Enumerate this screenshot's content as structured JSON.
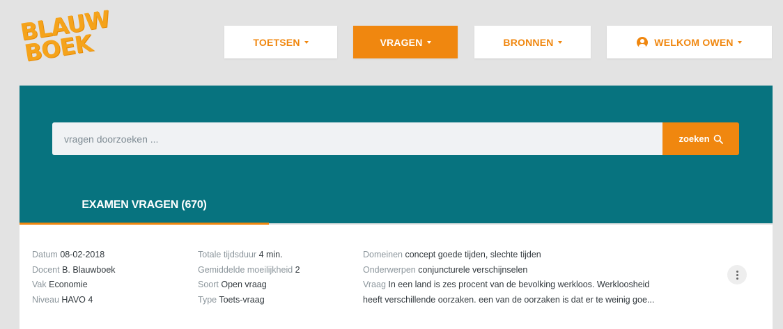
{
  "logo": {
    "line1": "BLAUW",
    "line2": "BOEK"
  },
  "nav": {
    "toetsen": "TOETSEN",
    "vragen": "VRAGEN",
    "bronnen": "BRONNEN",
    "user": "WELKOM OWEN"
  },
  "search": {
    "placeholder": "vragen doorzoeken ...",
    "button": "zoeken"
  },
  "tab": {
    "label": "EXAMEN VRAGEN (670)"
  },
  "result": {
    "datum": {
      "label": "Datum",
      "value": "08-02-2018"
    },
    "docent": {
      "label": "Docent",
      "value": "B. Blauwboek"
    },
    "vak": {
      "label": "Vak",
      "value": "Economie"
    },
    "niveau": {
      "label": "Niveau",
      "value": "HAVO 4"
    },
    "tijdsduur": {
      "label": "Totale tijdsduur",
      "value": "4 min."
    },
    "moeilijkheid": {
      "label": "Gemiddelde moeilijkheid",
      "value": "2"
    },
    "soort": {
      "label": "Soort",
      "value": "Open vraag"
    },
    "type": {
      "label": "Type",
      "value": "Toets-vraag"
    },
    "domeinen": {
      "label": "Domeinen",
      "value": "concept goede tijden, slechte tijden"
    },
    "onderwerpen": {
      "label": "Onderwerpen",
      "value": "conjuncturele verschijnselen"
    },
    "vraag": {
      "label": "Vraag",
      "line1": "In een land is zes procent van de bevolking werkloos. Werkloosheid",
      "line2": "heeft verschillende oorzaken. een van de oorzaken is dat er te weinig goe..."
    }
  },
  "colors": {
    "accent": "#f0870f",
    "teal": "#07737f",
    "background": "#e3e3e3"
  }
}
